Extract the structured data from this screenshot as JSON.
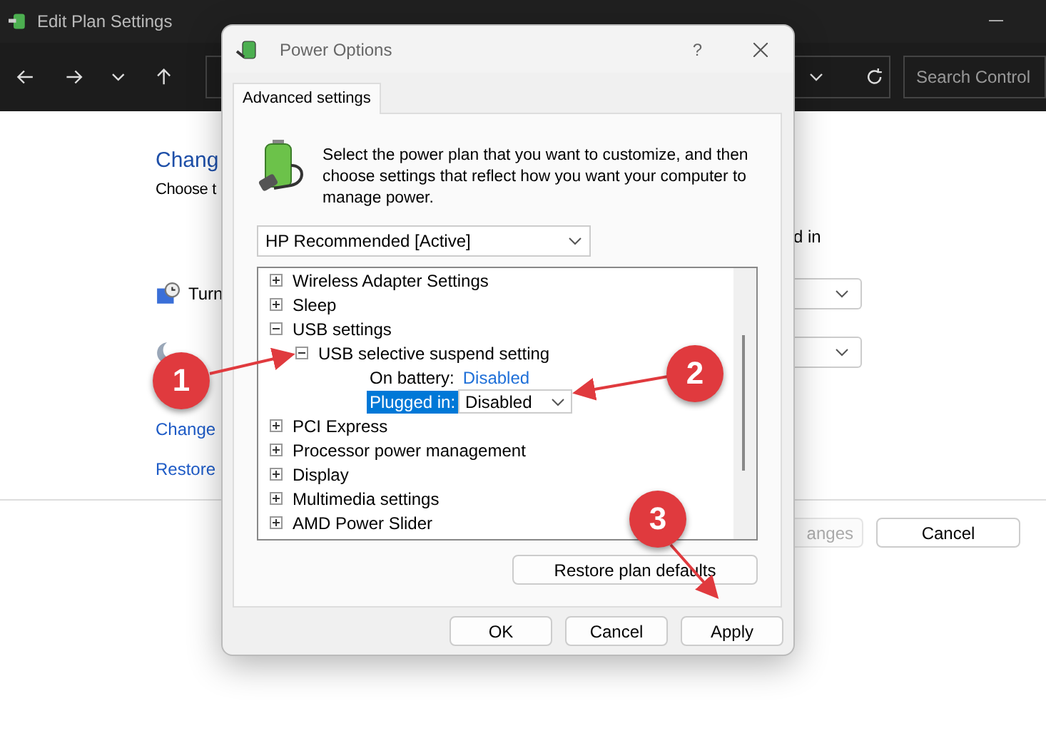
{
  "window": {
    "title": "Edit Plan Settings"
  },
  "toolbar": {
    "search": {
      "placeholder": "Search Control"
    }
  },
  "page": {
    "heading": "Chang",
    "subheading": "Choose t",
    "column_header": "d in",
    "settings": [
      {
        "kind": "display",
        "label": "Turn"
      },
      {
        "kind": "sleep"
      }
    ],
    "links": [
      "Change",
      "Restore"
    ],
    "buttons": [
      {
        "label": "anges",
        "disabled": true
      },
      {
        "label": "Cancel",
        "disabled": false
      }
    ]
  },
  "dialog": {
    "title": "Power Options",
    "help": "?",
    "tabs": [
      {
        "label": "Advanced settings",
        "selected": true
      }
    ],
    "description": "Select the power plan that you want to customize, and then choose settings that reflect how you want your computer to manage power.",
    "plan_select": {
      "value": "HP Recommended [Active]"
    },
    "tree": [
      {
        "label": "Wireless Adapter Settings",
        "expanded": false
      },
      {
        "label": "Sleep",
        "expanded": false
      },
      {
        "label": "USB settings",
        "expanded": true,
        "children": [
          {
            "label": "USB selective suspend setting",
            "expanded": true,
            "children": [
              {
                "kind": "setting",
                "label": "On battery:",
                "value": "Disabled",
                "selected": false
              },
              {
                "kind": "setting",
                "label": "Plugged in:",
                "value": "Disabled",
                "selected": true
              }
            ]
          }
        ]
      },
      {
        "label": "PCI Express",
        "expanded": false
      },
      {
        "label": "Processor power management",
        "expanded": false
      },
      {
        "label": "Display",
        "expanded": false
      },
      {
        "label": "Multimedia settings",
        "expanded": false
      },
      {
        "label": "AMD Power Slider",
        "expanded": false
      }
    ],
    "restore_button": "Restore plan defaults",
    "buttons": [
      "OK",
      "Cancel",
      "Apply"
    ]
  },
  "annotations": [
    {
      "number": "1"
    },
    {
      "number": "2"
    },
    {
      "number": "3"
    }
  ]
}
